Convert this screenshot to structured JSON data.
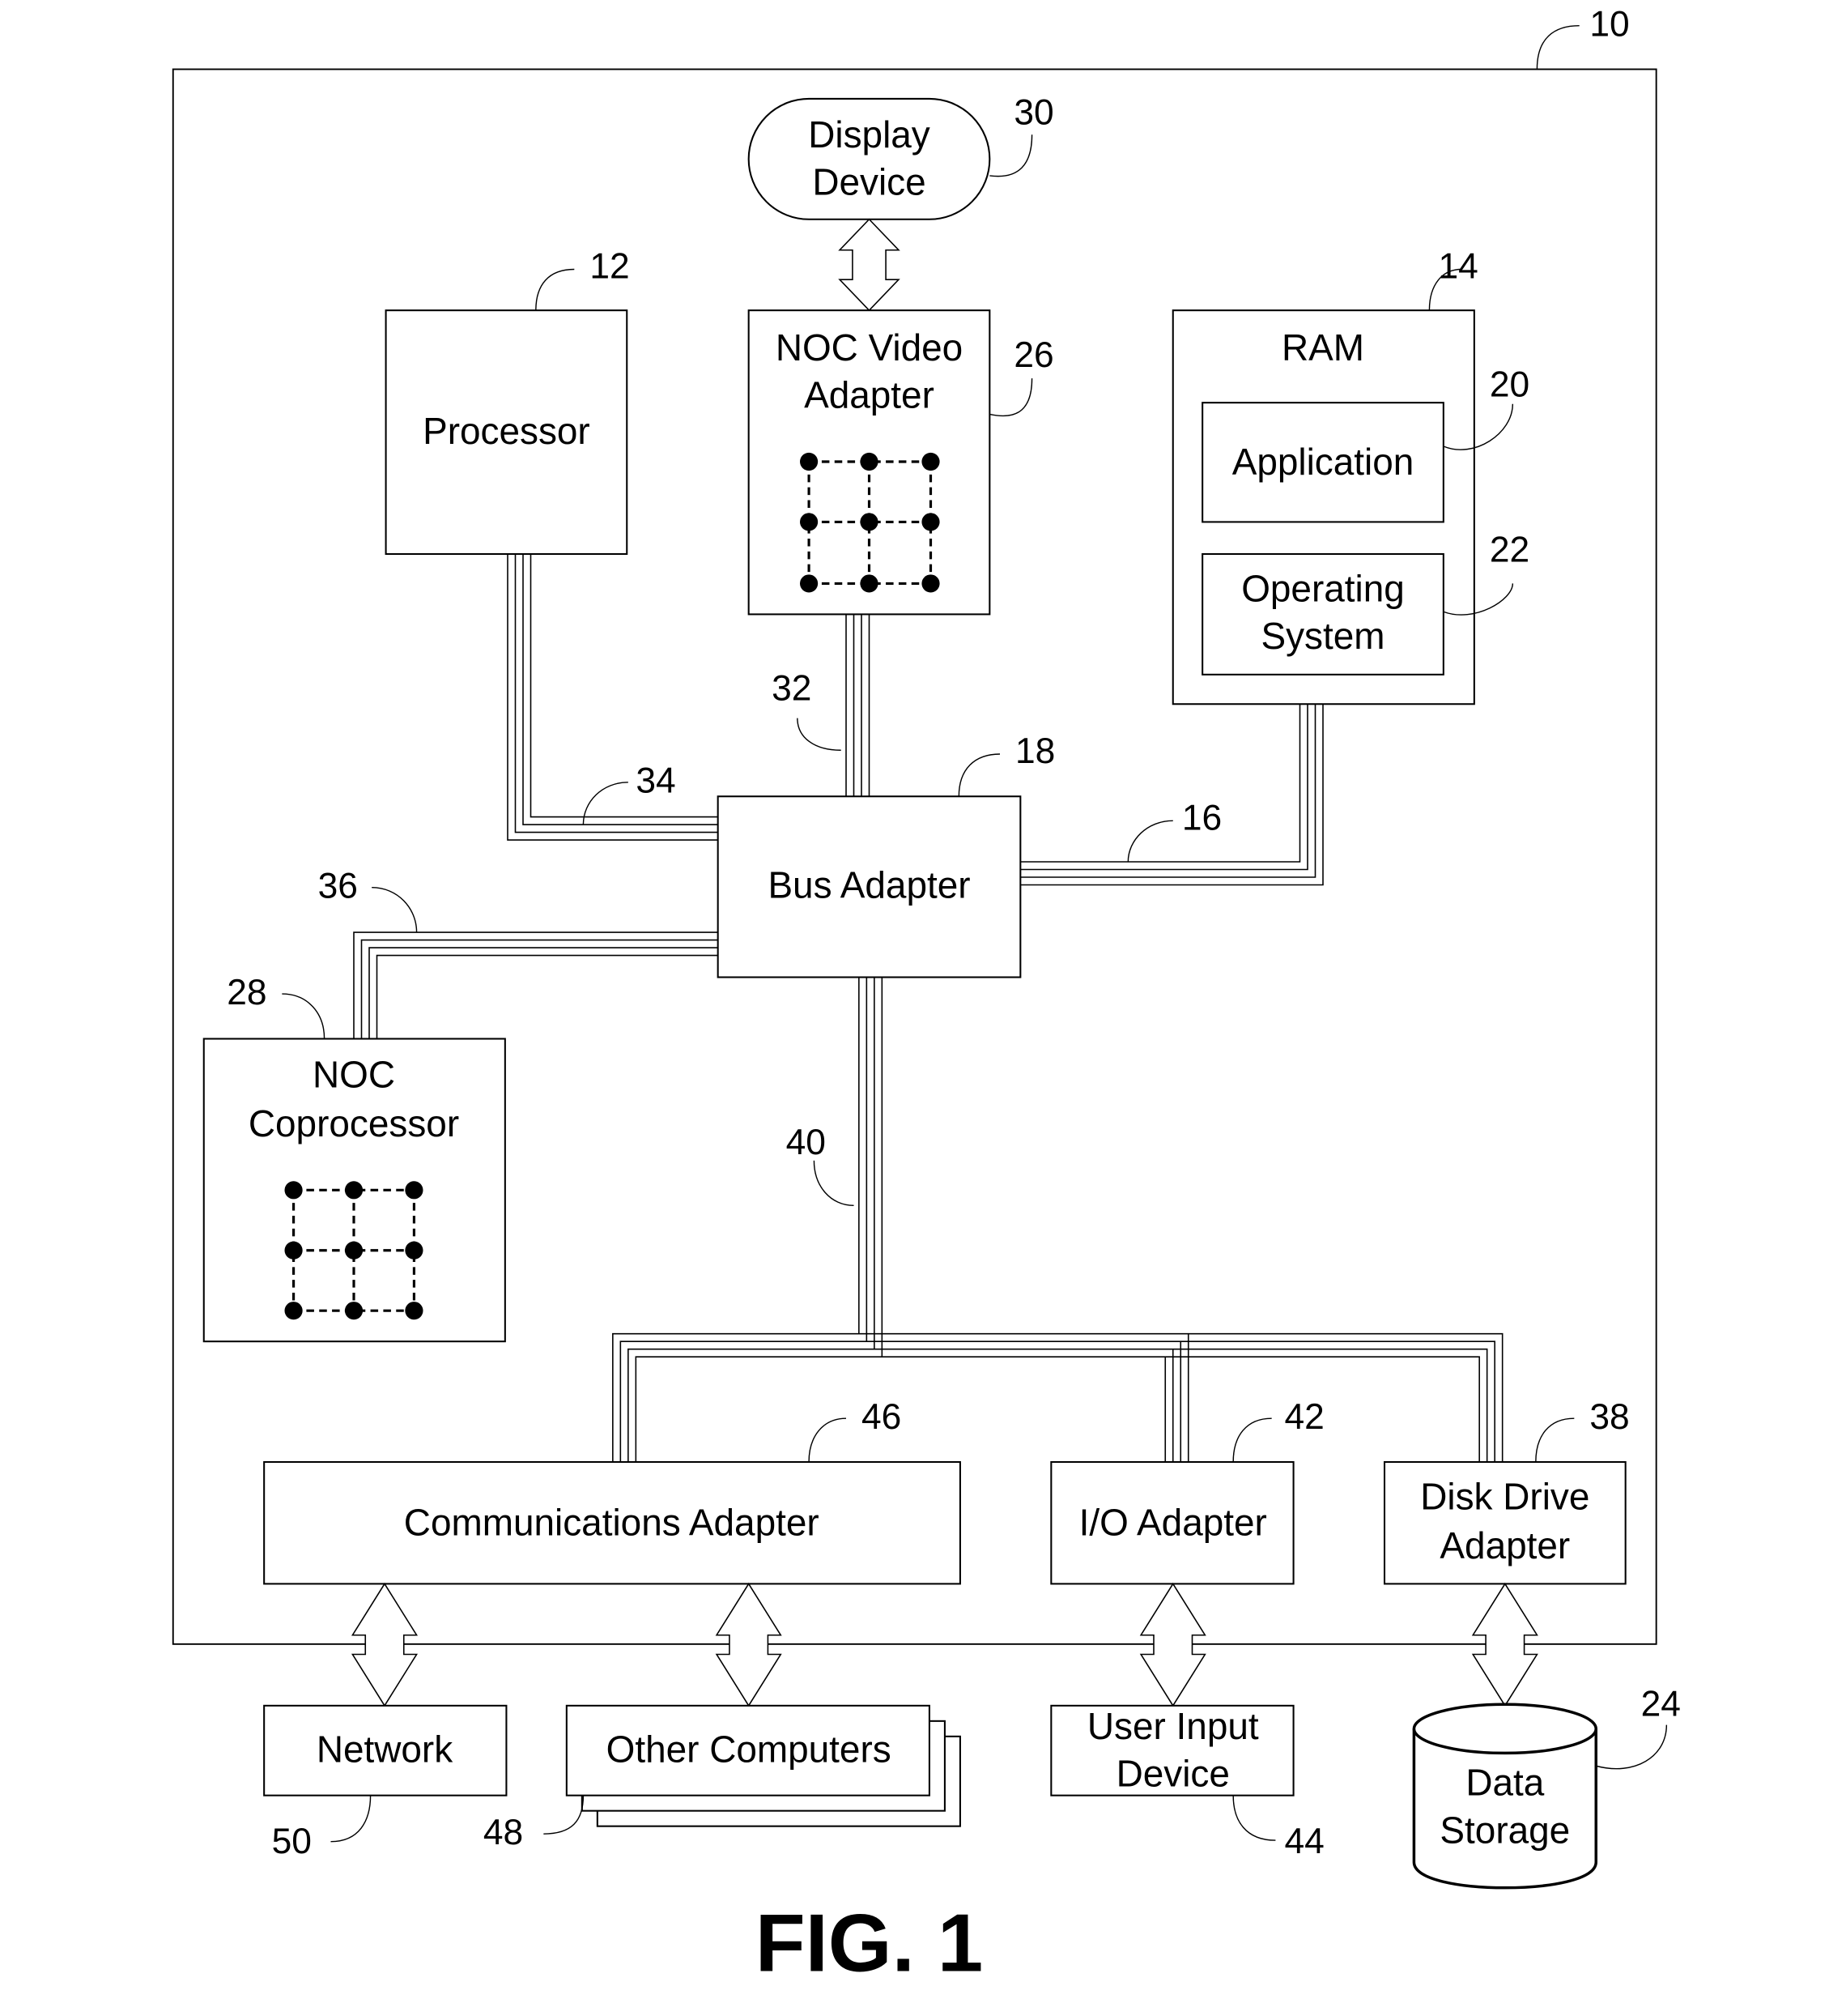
{
  "figure": {
    "title": "FIG. 1",
    "system_ref": "10"
  },
  "components": {
    "display_device": {
      "label_lines": [
        "Display",
        "Device"
      ],
      "ref": "30"
    },
    "processor": {
      "label_lines": [
        "Processor"
      ],
      "ref": "12"
    },
    "noc_video_adapter": {
      "label_lines": [
        "NOC Video",
        "Adapter"
      ],
      "ref": "26"
    },
    "ram": {
      "label_lines": [
        "RAM"
      ],
      "ref": "14"
    },
    "application": {
      "label_lines": [
        "Application"
      ],
      "ref": "20"
    },
    "operating_system": {
      "label_lines": [
        "Operating",
        "System"
      ],
      "ref": "22"
    },
    "bus_adapter": {
      "label_lines": [
        "Bus Adapter"
      ],
      "ref": "18"
    },
    "noc_coprocessor": {
      "label_lines": [
        "NOC",
        "Coprocessor"
      ],
      "ref": "28"
    },
    "communications_adapter": {
      "label_lines": [
        "Communications Adapter"
      ],
      "ref": "46"
    },
    "io_adapter": {
      "label_lines": [
        "I/O Adapter"
      ],
      "ref": "42"
    },
    "disk_drive_adapter": {
      "label_lines": [
        "Disk Drive",
        "Adapter"
      ],
      "ref": "38"
    },
    "network": {
      "label_lines": [
        "Network"
      ],
      "ref": "50"
    },
    "other_computers": {
      "label_lines": [
        "Other Computers"
      ],
      "ref": "48"
    },
    "user_input_device": {
      "label_lines": [
        "User Input",
        "Device"
      ],
      "ref": "44"
    },
    "data_storage": {
      "label_lines": [
        "Data",
        "Storage"
      ],
      "ref": "24"
    }
  },
  "buses": {
    "video_bus": {
      "ref": "32"
    },
    "front_side_bus": {
      "ref": "34"
    },
    "memory_bus": {
      "ref": "16"
    },
    "coprocessor_bus": {
      "ref": "36"
    },
    "expansion_bus": {
      "ref": "40"
    }
  }
}
